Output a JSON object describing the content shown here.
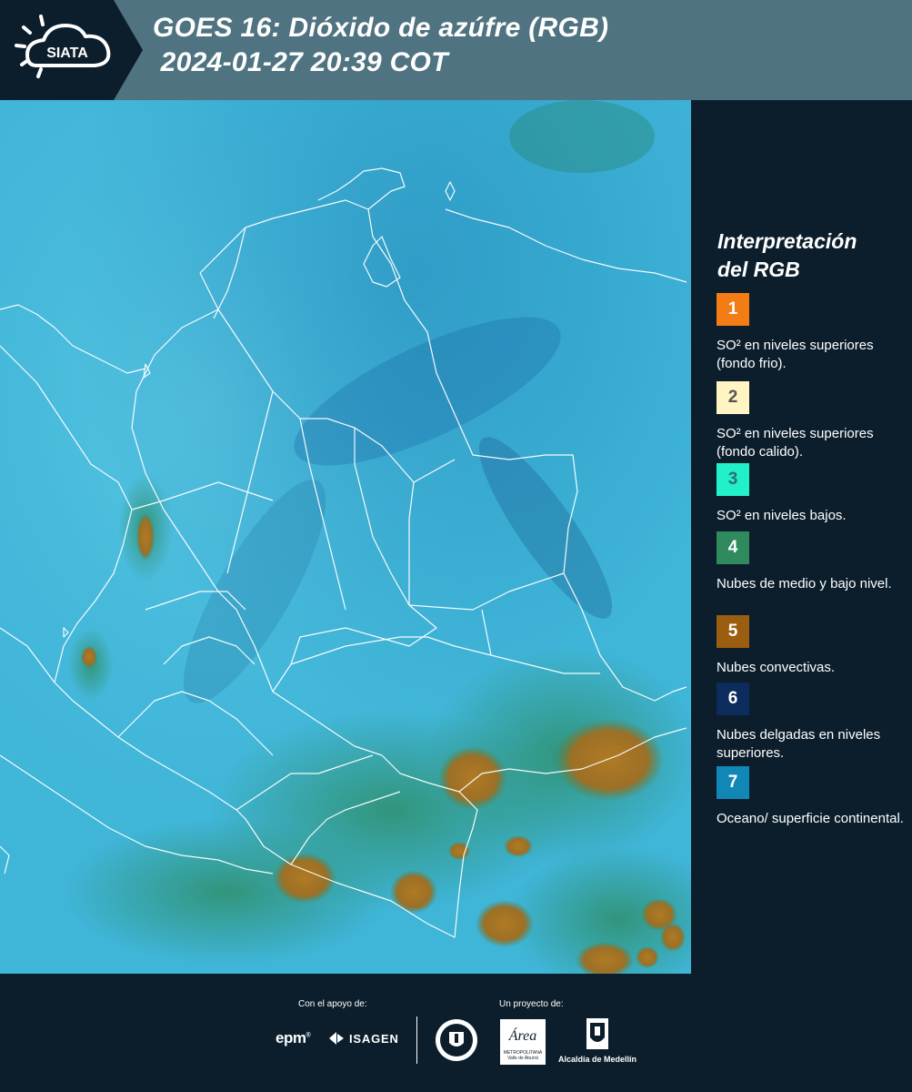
{
  "header": {
    "logo_text": "SIATA",
    "title_line1": "GOES 16: Dióxido de azúfre (RGB)",
    "title_line2": " 2024-01-27 20:39 COT"
  },
  "legend": {
    "title_line1": "Interpretación",
    "title_line2": "del RGB",
    "items": [
      {
        "number": "1",
        "color": "#f47c14",
        "text_color": "#ffffff",
        "text": "SO² en niveles superiores (fondo frio)."
      },
      {
        "number": "2",
        "color": "#fff4c2",
        "text_color": "#555555",
        "text": "SO² en niveles superiores (fondo calido)."
      },
      {
        "number": "3",
        "color": "#21f0c9",
        "text_color": "#2c6f74",
        "text": "SO² en niveles bajos."
      },
      {
        "number": "4",
        "color": "#2f8a5e",
        "text_color": "#ffffff",
        "text": "Nubes de medio y bajo nivel."
      },
      {
        "number": "5",
        "color": "#9b5d10",
        "text_color": "#ffffff",
        "text": "Nubes convectivas."
      },
      {
        "number": "6",
        "color": "#0b2c5c",
        "text_color": "#ffffff",
        "text": "Nubes delgadas en niveles superiores."
      },
      {
        "number": "7",
        "color": "#1187b8",
        "text_color": "#ffffff",
        "text": "Oceano/ superficie continental."
      }
    ]
  },
  "footer": {
    "support_label": "Con el apoyo de:",
    "project_label": "Un proyecto de:",
    "epm_text": "epm",
    "isagen_text": "ISAGEN",
    "area_text": "Área",
    "area_sub1": "METROPOLITANA",
    "area_sub2": "Valle de Aburrá",
    "alcaldia_text": "Alcaldía de Medellín"
  },
  "colors": {
    "header_bg": "#4f7380",
    "panel_bg": "#0c1e2c",
    "map_base": "#3fb5d8",
    "convective_cloud": "#b07a24",
    "low_cloud": "#2f8a5e"
  }
}
